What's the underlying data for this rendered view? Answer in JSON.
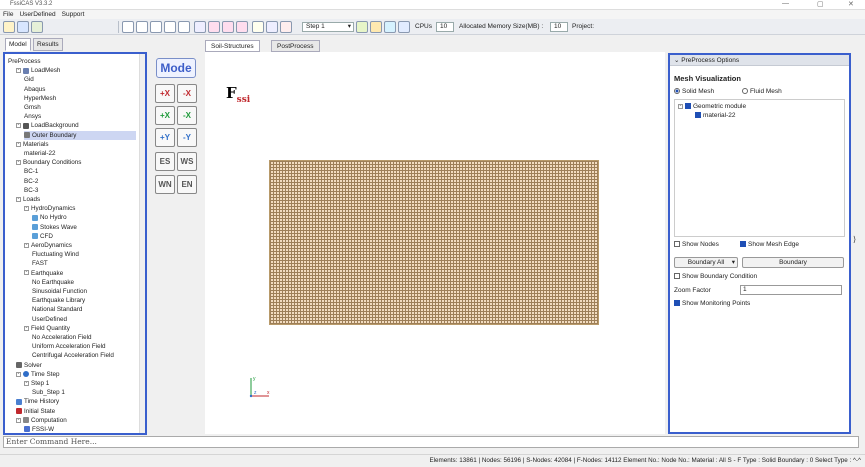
{
  "window": {
    "title": "FssiCAS V3.3.2",
    "controls": [
      "—",
      "▢",
      "✕"
    ]
  },
  "menu": [
    "File",
    "UserDefined",
    "Support"
  ],
  "toolbar": {
    "step_select": "Step 1",
    "cpus_label": "CPUs",
    "cpus_value": "10",
    "memory_label": "Allocated Memory Size(MB) :",
    "memory_value": "10",
    "project_label": "Project:"
  },
  "left_tabs": [
    "Model",
    "Results"
  ],
  "tree": [
    {
      "label": "PreProcess",
      "level": 0,
      "expand": "",
      "icon": ""
    },
    {
      "label": "LoadMesh",
      "level": 1,
      "expand": "-",
      "icon": "grid"
    },
    {
      "label": "Gid",
      "level": 2,
      "expand": "",
      "icon": ""
    },
    {
      "label": "Abaqus",
      "level": 2,
      "expand": "",
      "icon": ""
    },
    {
      "label": "HyperMesh",
      "level": 2,
      "expand": "",
      "icon": ""
    },
    {
      "label": "Gmsh",
      "level": 2,
      "expand": "",
      "icon": ""
    },
    {
      "label": "Ansys",
      "level": 2,
      "expand": "",
      "icon": ""
    },
    {
      "label": "LoadBackground",
      "level": 1,
      "expand": "-",
      "icon": "funnel"
    },
    {
      "label": "Outer Boundary",
      "level": 2,
      "expand": "",
      "icon": "boundary",
      "selected": true
    },
    {
      "label": "Materials",
      "level": 1,
      "expand": "-",
      "icon": ""
    },
    {
      "label": "material-22",
      "level": 2,
      "expand": "",
      "icon": ""
    },
    {
      "label": "Boundary Conditions",
      "level": 1,
      "expand": "-",
      "icon": ""
    },
    {
      "label": "BC-1",
      "level": 2,
      "expand": "",
      "icon": ""
    },
    {
      "label": "BC-2",
      "level": 2,
      "expand": "",
      "icon": ""
    },
    {
      "label": "BC-3",
      "level": 2,
      "expand": "",
      "icon": ""
    },
    {
      "label": "Loads",
      "level": 1,
      "expand": "-",
      "icon": ""
    },
    {
      "label": "HydroDynamics",
      "level": 2,
      "expand": "-",
      "icon": ""
    },
    {
      "label": "No Hydro",
      "level": 3,
      "expand": "",
      "icon": "wave"
    },
    {
      "label": "Stokes Wave",
      "level": 3,
      "expand": "",
      "icon": "wave"
    },
    {
      "label": "CFD",
      "level": 3,
      "expand": "",
      "icon": "wave"
    },
    {
      "label": "AeroDynamics",
      "level": 2,
      "expand": "-",
      "icon": ""
    },
    {
      "label": "Fluctuating Wind",
      "level": 3,
      "expand": "",
      "icon": ""
    },
    {
      "label": "FAST",
      "level": 3,
      "expand": "",
      "icon": ""
    },
    {
      "label": "Earthquake",
      "level": 2,
      "expand": "-",
      "icon": ""
    },
    {
      "label": "No Earthquake",
      "level": 3,
      "expand": "",
      "icon": ""
    },
    {
      "label": "Sinusoidal Function",
      "level": 3,
      "expand": "",
      "icon": ""
    },
    {
      "label": "Earthquake Library",
      "level": 3,
      "expand": "",
      "icon": ""
    },
    {
      "label": "National Standard",
      "level": 3,
      "expand": "",
      "icon": ""
    },
    {
      "label": "UserDefined",
      "level": 3,
      "expand": "",
      "icon": ""
    },
    {
      "label": "Field Quantity",
      "level": 2,
      "expand": "-",
      "icon": ""
    },
    {
      "label": "No Acceleration Field",
      "level": 3,
      "expand": "",
      "icon": ""
    },
    {
      "label": "Uniform Acceleration Field",
      "level": 3,
      "expand": "",
      "icon": ""
    },
    {
      "label": "Centrifugal Acceleration Field",
      "level": 3,
      "expand": "",
      "icon": ""
    },
    {
      "label": "Solver",
      "level": 1,
      "expand": "",
      "icon": "solver"
    },
    {
      "label": "Time Step",
      "level": 1,
      "expand": "-",
      "icon": "clock"
    },
    {
      "label": "Step 1",
      "level": 2,
      "expand": "-",
      "icon": ""
    },
    {
      "label": "Sub_Step 1",
      "level": 3,
      "expand": "",
      "icon": ""
    },
    {
      "label": "Time History",
      "level": 1,
      "expand": "",
      "icon": "history"
    },
    {
      "label": "Initial State",
      "level": 1,
      "expand": "",
      "icon": "state"
    },
    {
      "label": "Computation",
      "level": 1,
      "expand": "-",
      "icon": "computation"
    },
    {
      "label": "FSSI-W",
      "level": 2,
      "expand": "",
      "icon": "fssi"
    }
  ],
  "mode_button": "Mode",
  "view_tabs": [
    "Soil-Structures",
    "PostProcess"
  ],
  "logo": {
    "main": "F",
    "sub": "ssi"
  },
  "axes": {
    "y": "y",
    "x": "x",
    "z": "z"
  },
  "preprocess": {
    "header": "PreProcess Options",
    "mesh_visualization": "Mesh Visualization",
    "solid_mesh": "Solid Mesh",
    "fluid_mesh": "Fluid Mesh",
    "geometric_module": "Geometric module",
    "material": "material-22",
    "show_nodes": "Show Nodes",
    "show_mesh_edge": "Show Mesh Edge",
    "boundary_all": "Boundary All",
    "boundary_button": "Boundary",
    "show_boundary_condition": "Show Boundary Condition",
    "zoom_factor_label": "Zoom Factor",
    "zoom_factor_value": "1",
    "show_monitoring_points": "Show Monitoring Points"
  },
  "command": {
    "placeholder": "Enter Command Here..."
  },
  "status": {
    "text": "Elements: 13861 | Nodes: 56196 | S-Nodes: 42084 | F-Nodes: 14112 Element No.:   Node No.:   Material :  All   S - F Type :  Solid   Boundary :  0   Select Type :  ^-^"
  }
}
